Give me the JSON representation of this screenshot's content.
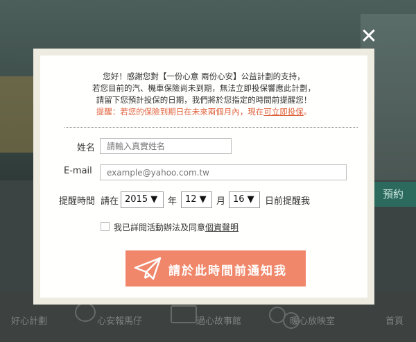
{
  "background": {
    "banner_text": "預約",
    "nav": [
      {
        "label": "好心計劃"
      },
      {
        "label": "心安報馬仔"
      },
      {
        "label": "過心故事館"
      },
      {
        "label": "暖心放映室"
      },
      {
        "label": "首頁"
      }
    ]
  },
  "modal": {
    "close_label": "✕",
    "message_lines": [
      "您好！感謝您對【一份心意 兩份心安】公益計劃的支持，",
      "若您目前的汽、機車保險尚未到期，無法立即投保響應此計劃，",
      "請留下您預計投保的日期，我們將於您指定的時間前提醒您！"
    ],
    "alert_prefix": "提醒：若您的保險到期日在未來兩個月內，現在",
    "alert_link": "可立即投保",
    "alert_suffix": "。",
    "form": {
      "name_label": "姓名",
      "name_placeholder": "請輸入真實姓名",
      "email_label": "E-mail",
      "email_placeholder": "example@yahoo.com.tw",
      "reminder_label": "提醒時間",
      "in_label": "請在",
      "year_value": "2015 ▼",
      "year_unit": "年",
      "month_value": "12 ▼",
      "month_unit": "月",
      "day_value": "16 ▼",
      "day_suffix": "日前提醒我",
      "agree_text": "我已詳閱活動辦法及同意",
      "agree_link": "個資聲明",
      "agree_checked": false
    },
    "submit_label": "請於此時間前通知我"
  },
  "colors": {
    "accent": "#f0876a",
    "alert": "#e0623d"
  }
}
